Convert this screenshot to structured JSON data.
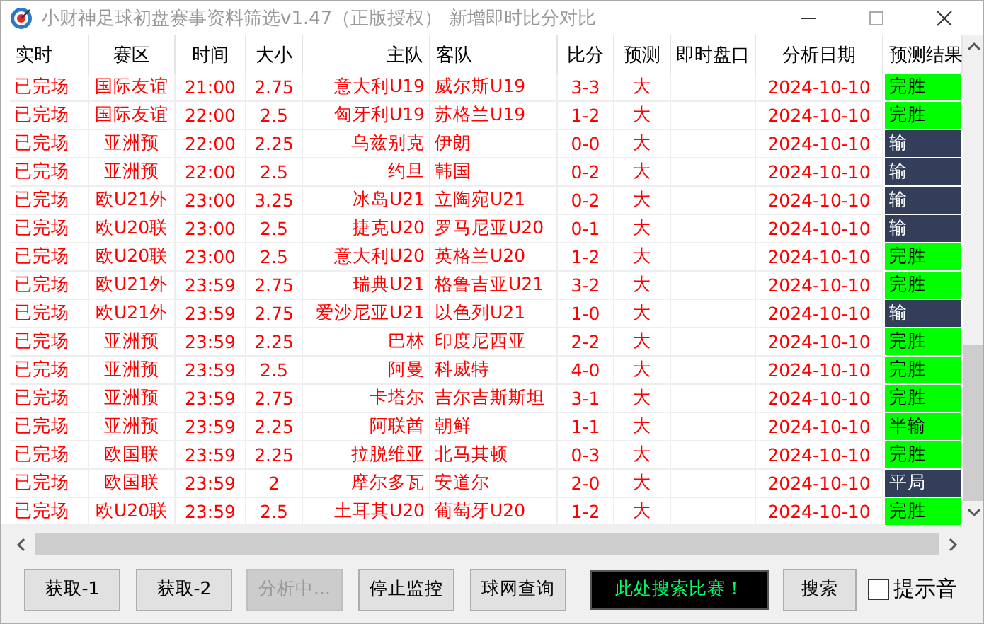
{
  "window": {
    "title": "小财神足球初盘赛事资料筛选v1.47（正版授权）   新增即时比分对比"
  },
  "table": {
    "columns": [
      "实时",
      "赛区",
      "时间",
      "大小",
      "主队",
      "客队",
      "比分",
      "预测",
      "即时盘口",
      "分析日期",
      "预测结果"
    ],
    "rows": [
      {
        "status": "已完场",
        "league": "国际友谊",
        "time": "21:00",
        "line": "2.75",
        "home": "意大利U19",
        "away": "威尔斯U19",
        "score": "3-3",
        "prediction": "大",
        "date": "2024-10-10",
        "result": {
          "text": "完胜",
          "color": "#00ff00"
        }
      },
      {
        "status": "已完场",
        "league": "国际友谊",
        "time": "22:00",
        "line": "2.5",
        "home": "匈牙利U19",
        "away": "苏格兰U19",
        "score": "1-2",
        "prediction": "大",
        "date": "2024-10-10",
        "result": {
          "text": "完胜",
          "color": "#00ff00"
        }
      },
      {
        "status": "已完场",
        "league": "亚洲预",
        "time": "22:00",
        "line": "2.25",
        "home": "乌兹别克",
        "away": "伊朗",
        "score": "0-0",
        "prediction": "大",
        "date": "2024-10-10",
        "result": {
          "text": "输",
          "color": "#333f5a"
        }
      },
      {
        "status": "已完场",
        "league": "亚洲预",
        "time": "22:00",
        "line": "2.5",
        "home": "约旦",
        "away": "韩国",
        "score": "0-2",
        "prediction": "大",
        "date": "2024-10-10",
        "result": {
          "text": "输",
          "color": "#333f5a"
        }
      },
      {
        "status": "已完场",
        "league": "欧U21外",
        "time": "23:00",
        "line": "3.25",
        "home": "冰岛U21",
        "away": "立陶宛U21",
        "score": "0-2",
        "prediction": "大",
        "date": "2024-10-10",
        "result": {
          "text": "输",
          "color": "#333f5a"
        }
      },
      {
        "status": "已完场",
        "league": "欧U20联",
        "time": "23:00",
        "line": "2.5",
        "home": "捷克U20",
        "away": "罗马尼亚U20",
        "score": "0-1",
        "prediction": "大",
        "date": "2024-10-10",
        "result": {
          "text": "输",
          "color": "#333f5a"
        }
      },
      {
        "status": "已完场",
        "league": "欧U20联",
        "time": "23:00",
        "line": "2.5",
        "home": "意大利U20",
        "away": "英格兰U20",
        "score": "1-2",
        "prediction": "大",
        "date": "2024-10-10",
        "result": {
          "text": "完胜",
          "color": "#00ff00"
        }
      },
      {
        "status": "已完场",
        "league": "欧U21外",
        "time": "23:59",
        "line": "2.75",
        "home": "瑞典U21",
        "away": "格鲁吉亚U21",
        "score": "3-2",
        "prediction": "大",
        "date": "2024-10-10",
        "result": {
          "text": "完胜",
          "color": "#00ff00"
        }
      },
      {
        "status": "已完场",
        "league": "欧U21外",
        "time": "23:59",
        "line": "2.75",
        "home": "爱沙尼亚U21",
        "away": "以色列U21",
        "score": "1-0",
        "prediction": "大",
        "date": "2024-10-10",
        "result": {
          "text": "输",
          "color": "#333f5a"
        }
      },
      {
        "status": "已完场",
        "league": "亚洲预",
        "time": "23:59",
        "line": "2.25",
        "home": "巴林",
        "away": "印度尼西亚",
        "score": "2-2",
        "prediction": "大",
        "date": "2024-10-10",
        "result": {
          "text": "完胜",
          "color": "#00ff00"
        }
      },
      {
        "status": "已完场",
        "league": "亚洲预",
        "time": "23:59",
        "line": "2.5",
        "home": "阿曼",
        "away": "科威特",
        "score": "4-0",
        "prediction": "大",
        "date": "2024-10-10",
        "result": {
          "text": "完胜",
          "color": "#00ff00"
        }
      },
      {
        "status": "已完场",
        "league": "亚洲预",
        "time": "23:59",
        "line": "2.75",
        "home": "卡塔尔",
        "away": "吉尔吉斯斯坦",
        "score": "3-1",
        "prediction": "大",
        "date": "2024-10-10",
        "result": {
          "text": "完胜",
          "color": "#00ff00"
        }
      },
      {
        "status": "已完场",
        "league": "亚洲预",
        "time": "23:59",
        "line": "2.25",
        "home": "阿联酋",
        "away": "朝鲜",
        "score": "1-1",
        "prediction": "大",
        "date": "2024-10-10",
        "result": {
          "text": "半输",
          "color": "#00ff00"
        }
      },
      {
        "status": "已完场",
        "league": "欧国联",
        "time": "23:59",
        "line": "2.25",
        "home": "拉脱维亚",
        "away": "北马其顿",
        "score": "0-3",
        "prediction": "大",
        "date": "2024-10-10",
        "result": {
          "text": "完胜",
          "color": "#00ff00"
        }
      },
      {
        "status": "已完场",
        "league": "欧国联",
        "time": "23:59",
        "line": "2",
        "home": "摩尔多瓦",
        "away": "安道尔",
        "score": "2-0",
        "prediction": "大",
        "date": "2024-10-10",
        "result": {
          "text": "平局",
          "color": "#333f5a"
        }
      },
      {
        "status": "已完场",
        "league": "欧U20联",
        "time": "23:59",
        "line": "2.5",
        "home": "土耳其U20",
        "away": "葡萄牙U20",
        "score": "1-2",
        "prediction": "大",
        "date": "2024-10-10",
        "result": {
          "text": "完胜",
          "color": "#00ff00"
        }
      }
    ]
  },
  "buttons": [
    {
      "label": "获取-1",
      "disabled": false
    },
    {
      "label": "获取-2",
      "disabled": false
    },
    {
      "label": "分析中...",
      "disabled": true
    },
    {
      "label": "停止监控",
      "disabled": false
    },
    {
      "label": "球网查询",
      "disabled": false
    }
  ],
  "search": {
    "value": "此处搜索比赛！",
    "button": "搜索"
  },
  "sound": {
    "label": "提示音",
    "checked": false
  }
}
